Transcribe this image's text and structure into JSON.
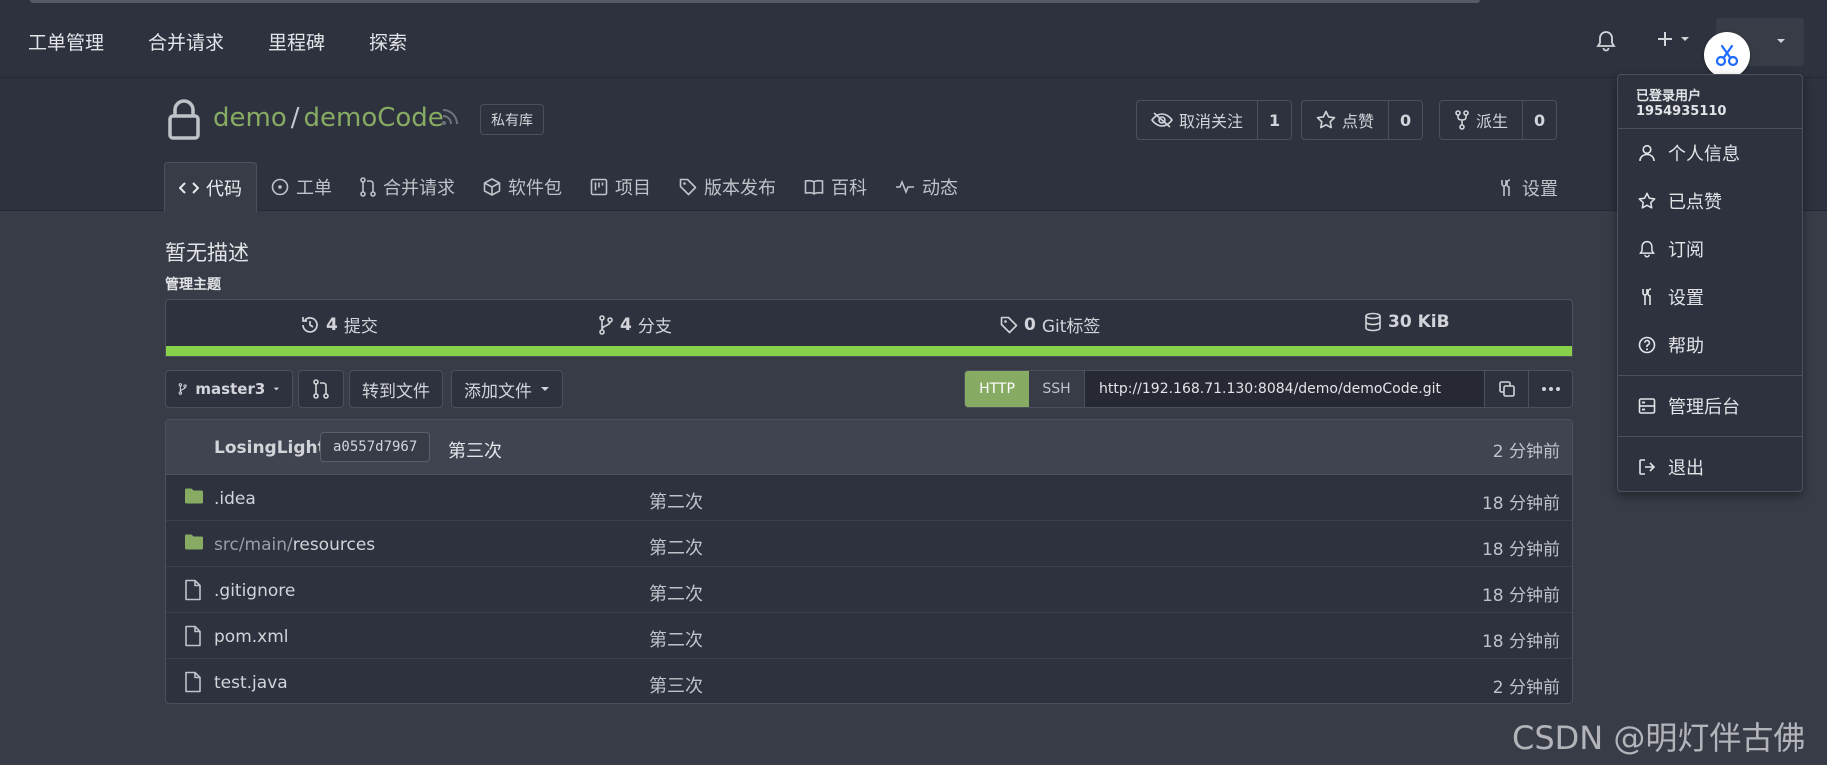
{
  "nav": {
    "items": [
      "工单管理",
      "合并请求",
      "里程碑",
      "探索"
    ]
  },
  "repo": {
    "owner": "demo",
    "separator": "/",
    "name": "demoCode",
    "badge": "私有库",
    "actions": {
      "unwatch_label": "取消关注",
      "unwatch_count": "1",
      "star_label": "点赞",
      "star_count": "0",
      "fork_label": "派生",
      "fork_count": "0"
    },
    "tabs": [
      {
        "label": "代码",
        "icon": "code-icon",
        "active": true
      },
      {
        "label": "工单",
        "icon": "issue-icon"
      },
      {
        "label": "合并请求",
        "icon": "pull-request-icon"
      },
      {
        "label": "软件包",
        "icon": "package-icon"
      },
      {
        "label": "项目",
        "icon": "project-icon"
      },
      {
        "label": "版本发布",
        "icon": "tag-icon"
      },
      {
        "label": "百科",
        "icon": "book-icon"
      },
      {
        "label": "动态",
        "icon": "pulse-icon"
      }
    ],
    "settings_label": "设置",
    "description": "暂无描述",
    "manage_topics": "管理主题"
  },
  "stats": {
    "commits_count": "4",
    "commits_label": "提交",
    "branches_count": "4",
    "branches_label": "分支",
    "tags_count": "0",
    "tags_label": "Git标签",
    "size": "30 KiB",
    "language_bar_color": "#88d14b"
  },
  "toolbar": {
    "branch": "master3",
    "goto_file": "转到文件",
    "add_file": "添加文件",
    "clone_http": "HTTP",
    "clone_ssh": "SSH",
    "clone_url": "http://192.168.71.130:8084/demo/demoCode.git"
  },
  "latest_commit": {
    "author": "LosingLight",
    "sha": "a0557d7967",
    "message": "第三次",
    "time": "2 分钟前"
  },
  "files": [
    {
      "type": "folder",
      "name_dim": "",
      "name": ".idea",
      "message": "第二次",
      "time": "18 分钟前"
    },
    {
      "type": "folder",
      "name_dim": "src/main/",
      "name": "resources",
      "message": "第二次",
      "time": "18 分钟前"
    },
    {
      "type": "file",
      "name_dim": "",
      "name": ".gitignore",
      "message": "第二次",
      "time": "18 分钟前"
    },
    {
      "type": "file",
      "name_dim": "",
      "name": "pom.xml",
      "message": "第二次",
      "time": "18 分钟前"
    },
    {
      "type": "file",
      "name_dim": "",
      "name": "test.java",
      "message": "第三次",
      "time": "2 分钟前"
    }
  ],
  "user_menu": {
    "header": "已登录用户 1954935110",
    "items": [
      {
        "label": "个人信息",
        "icon": "person-icon"
      },
      {
        "label": "已点赞",
        "icon": "star-icon"
      },
      {
        "label": "订阅",
        "icon": "bell-icon"
      },
      {
        "label": "设置",
        "icon": "tools-icon"
      },
      {
        "label": "帮助",
        "icon": "question-icon"
      }
    ],
    "admin": "管理后台",
    "logout": "退出"
  },
  "watermark": "CSDN @明灯伴古佛",
  "colors": {
    "accent_green": "#87ab63",
    "background": "#383c47",
    "header_bg": "#2e323e"
  }
}
